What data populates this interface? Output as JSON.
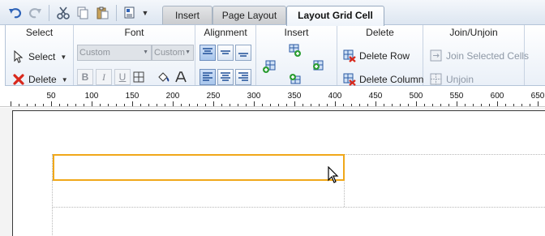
{
  "quick_access": {
    "undo_icon": "undo-icon",
    "redo_icon": "redo-icon",
    "cut_icon": "cut-icon",
    "copy_icon": "copy-icon",
    "paste_icon": "paste-icon",
    "component_icon": "component-icon"
  },
  "tabs": [
    {
      "label": "Insert",
      "active": false
    },
    {
      "label": "Page Layout",
      "active": false
    },
    {
      "label": "Layout Grid Cell",
      "active": true
    }
  ],
  "ribbon": {
    "select": {
      "title": "Select",
      "select_label": "Select",
      "delete_label": "Delete"
    },
    "font": {
      "title": "Font",
      "font_name": "Custom",
      "font_size": "Custom",
      "bold": "B",
      "italic": "I",
      "underline": "U"
    },
    "alignment": {
      "title": "Alignment"
    },
    "insert": {
      "title": "Insert"
    },
    "delete": {
      "title": "Delete",
      "delete_row": "Delete Row",
      "delete_column": "Delete Column"
    },
    "join": {
      "title": "Join/Unjoin",
      "join_selected": "Join Selected Cells",
      "unjoin": "Unjoin"
    }
  },
  "ruler": {
    "labels": [
      "50",
      "100",
      "150",
      "200",
      "250",
      "300",
      "350",
      "400",
      "450",
      "500",
      "550",
      "600",
      "650"
    ]
  },
  "colors": {
    "selection": "#f0a81a",
    "ribbon_border": "#b4c4d8",
    "delete_red": "#d8281c",
    "insert_green": "#2e9e35"
  }
}
